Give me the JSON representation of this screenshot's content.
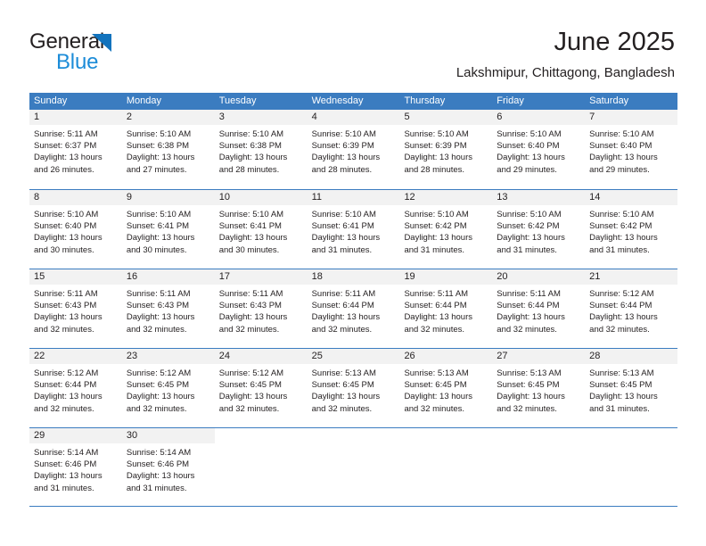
{
  "brand": {
    "word_one": "General",
    "word_two": "Blue",
    "triangle_icon": "triangle-logo-icon",
    "triangle_color": "#1273bd",
    "blue_text_color": "#1c8cd8"
  },
  "header": {
    "title": "June 2025",
    "subtitle": "Lakshmipur, Chittagong, Bangladesh"
  },
  "theme": {
    "header_blue": "#3b7cc0",
    "day_strip_gray": "#f2f2f2",
    "text_color": "#231f20"
  },
  "calendar": {
    "weekdays": [
      "Sunday",
      "Monday",
      "Tuesday",
      "Wednesday",
      "Thursday",
      "Friday",
      "Saturday"
    ],
    "weeks": [
      [
        {
          "day": "1",
          "sunrise": "Sunrise: 5:11 AM",
          "sunset": "Sunset: 6:37 PM",
          "daylight_1": "Daylight: 13 hours",
          "daylight_2": "and 26 minutes."
        },
        {
          "day": "2",
          "sunrise": "Sunrise: 5:10 AM",
          "sunset": "Sunset: 6:38 PM",
          "daylight_1": "Daylight: 13 hours",
          "daylight_2": "and 27 minutes."
        },
        {
          "day": "3",
          "sunrise": "Sunrise: 5:10 AM",
          "sunset": "Sunset: 6:38 PM",
          "daylight_1": "Daylight: 13 hours",
          "daylight_2": "and 28 minutes."
        },
        {
          "day": "4",
          "sunrise": "Sunrise: 5:10 AM",
          "sunset": "Sunset: 6:39 PM",
          "daylight_1": "Daylight: 13 hours",
          "daylight_2": "and 28 minutes."
        },
        {
          "day": "5",
          "sunrise": "Sunrise: 5:10 AM",
          "sunset": "Sunset: 6:39 PM",
          "daylight_1": "Daylight: 13 hours",
          "daylight_2": "and 28 minutes."
        },
        {
          "day": "6",
          "sunrise": "Sunrise: 5:10 AM",
          "sunset": "Sunset: 6:40 PM",
          "daylight_1": "Daylight: 13 hours",
          "daylight_2": "and 29 minutes."
        },
        {
          "day": "7",
          "sunrise": "Sunrise: 5:10 AM",
          "sunset": "Sunset: 6:40 PM",
          "daylight_1": "Daylight: 13 hours",
          "daylight_2": "and 29 minutes."
        }
      ],
      [
        {
          "day": "8",
          "sunrise": "Sunrise: 5:10 AM",
          "sunset": "Sunset: 6:40 PM",
          "daylight_1": "Daylight: 13 hours",
          "daylight_2": "and 30 minutes."
        },
        {
          "day": "9",
          "sunrise": "Sunrise: 5:10 AM",
          "sunset": "Sunset: 6:41 PM",
          "daylight_1": "Daylight: 13 hours",
          "daylight_2": "and 30 minutes."
        },
        {
          "day": "10",
          "sunrise": "Sunrise: 5:10 AM",
          "sunset": "Sunset: 6:41 PM",
          "daylight_1": "Daylight: 13 hours",
          "daylight_2": "and 30 minutes."
        },
        {
          "day": "11",
          "sunrise": "Sunrise: 5:10 AM",
          "sunset": "Sunset: 6:41 PM",
          "daylight_1": "Daylight: 13 hours",
          "daylight_2": "and 31 minutes."
        },
        {
          "day": "12",
          "sunrise": "Sunrise: 5:10 AM",
          "sunset": "Sunset: 6:42 PM",
          "daylight_1": "Daylight: 13 hours",
          "daylight_2": "and 31 minutes."
        },
        {
          "day": "13",
          "sunrise": "Sunrise: 5:10 AM",
          "sunset": "Sunset: 6:42 PM",
          "daylight_1": "Daylight: 13 hours",
          "daylight_2": "and 31 minutes."
        },
        {
          "day": "14",
          "sunrise": "Sunrise: 5:10 AM",
          "sunset": "Sunset: 6:42 PM",
          "daylight_1": "Daylight: 13 hours",
          "daylight_2": "and 31 minutes."
        }
      ],
      [
        {
          "day": "15",
          "sunrise": "Sunrise: 5:11 AM",
          "sunset": "Sunset: 6:43 PM",
          "daylight_1": "Daylight: 13 hours",
          "daylight_2": "and 32 minutes."
        },
        {
          "day": "16",
          "sunrise": "Sunrise: 5:11 AM",
          "sunset": "Sunset: 6:43 PM",
          "daylight_1": "Daylight: 13 hours",
          "daylight_2": "and 32 minutes."
        },
        {
          "day": "17",
          "sunrise": "Sunrise: 5:11 AM",
          "sunset": "Sunset: 6:43 PM",
          "daylight_1": "Daylight: 13 hours",
          "daylight_2": "and 32 minutes."
        },
        {
          "day": "18",
          "sunrise": "Sunrise: 5:11 AM",
          "sunset": "Sunset: 6:44 PM",
          "daylight_1": "Daylight: 13 hours",
          "daylight_2": "and 32 minutes."
        },
        {
          "day": "19",
          "sunrise": "Sunrise: 5:11 AM",
          "sunset": "Sunset: 6:44 PM",
          "daylight_1": "Daylight: 13 hours",
          "daylight_2": "and 32 minutes."
        },
        {
          "day": "20",
          "sunrise": "Sunrise: 5:11 AM",
          "sunset": "Sunset: 6:44 PM",
          "daylight_1": "Daylight: 13 hours",
          "daylight_2": "and 32 minutes."
        },
        {
          "day": "21",
          "sunrise": "Sunrise: 5:12 AM",
          "sunset": "Sunset: 6:44 PM",
          "daylight_1": "Daylight: 13 hours",
          "daylight_2": "and 32 minutes."
        }
      ],
      [
        {
          "day": "22",
          "sunrise": "Sunrise: 5:12 AM",
          "sunset": "Sunset: 6:44 PM",
          "daylight_1": "Daylight: 13 hours",
          "daylight_2": "and 32 minutes."
        },
        {
          "day": "23",
          "sunrise": "Sunrise: 5:12 AM",
          "sunset": "Sunset: 6:45 PM",
          "daylight_1": "Daylight: 13 hours",
          "daylight_2": "and 32 minutes."
        },
        {
          "day": "24",
          "sunrise": "Sunrise: 5:12 AM",
          "sunset": "Sunset: 6:45 PM",
          "daylight_1": "Daylight: 13 hours",
          "daylight_2": "and 32 minutes."
        },
        {
          "day": "25",
          "sunrise": "Sunrise: 5:13 AM",
          "sunset": "Sunset: 6:45 PM",
          "daylight_1": "Daylight: 13 hours",
          "daylight_2": "and 32 minutes."
        },
        {
          "day": "26",
          "sunrise": "Sunrise: 5:13 AM",
          "sunset": "Sunset: 6:45 PM",
          "daylight_1": "Daylight: 13 hours",
          "daylight_2": "and 32 minutes."
        },
        {
          "day": "27",
          "sunrise": "Sunrise: 5:13 AM",
          "sunset": "Sunset: 6:45 PM",
          "daylight_1": "Daylight: 13 hours",
          "daylight_2": "and 32 minutes."
        },
        {
          "day": "28",
          "sunrise": "Sunrise: 5:13 AM",
          "sunset": "Sunset: 6:45 PM",
          "daylight_1": "Daylight: 13 hours",
          "daylight_2": "and 31 minutes."
        }
      ],
      [
        {
          "day": "29",
          "sunrise": "Sunrise: 5:14 AM",
          "sunset": "Sunset: 6:46 PM",
          "daylight_1": "Daylight: 13 hours",
          "daylight_2": "and 31 minutes."
        },
        {
          "day": "30",
          "sunrise": "Sunrise: 5:14 AM",
          "sunset": "Sunset: 6:46 PM",
          "daylight_1": "Daylight: 13 hours",
          "daylight_2": "and 31 minutes."
        },
        {
          "day": "",
          "sunrise": "",
          "sunset": "",
          "daylight_1": "",
          "daylight_2": ""
        },
        {
          "day": "",
          "sunrise": "",
          "sunset": "",
          "daylight_1": "",
          "daylight_2": ""
        },
        {
          "day": "",
          "sunrise": "",
          "sunset": "",
          "daylight_1": "",
          "daylight_2": ""
        },
        {
          "day": "",
          "sunrise": "",
          "sunset": "",
          "daylight_1": "",
          "daylight_2": ""
        },
        {
          "day": "",
          "sunrise": "",
          "sunset": "",
          "daylight_1": "",
          "daylight_2": ""
        }
      ]
    ]
  }
}
